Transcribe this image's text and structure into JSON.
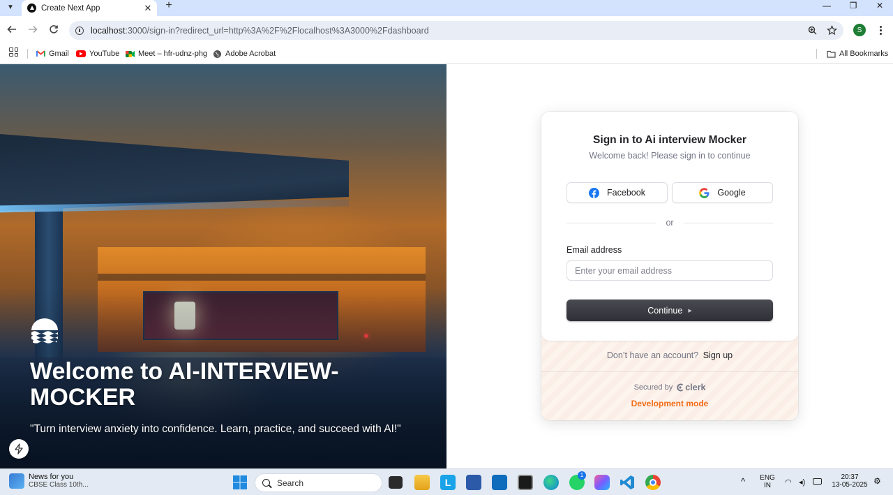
{
  "browser": {
    "tab_title": "Create Next App",
    "url_host": "localhost",
    "url_path": ":3000/sign-in?redirect_url=http%3A%2F%2Flocalhost%3A3000%2Fdashboard",
    "profile_initial": "S"
  },
  "bookmarks": {
    "items": [
      {
        "label": "Gmail",
        "icon": "gmail-icon"
      },
      {
        "label": "YouTube",
        "icon": "youtube-icon"
      },
      {
        "label": "Meet – hfr-udnz-phg",
        "icon": "meet-icon"
      },
      {
        "label": "Adobe Acrobat",
        "icon": "globe-icon"
      }
    ],
    "all_bookmarks": "All Bookmarks"
  },
  "hero": {
    "title": "Welcome to AI-INTERVIEW-MOCKER",
    "quote": "\"Turn interview anxiety into confidence. Learn, practice, and succeed with AI!\""
  },
  "signin": {
    "title": "Sign in to Ai interview Mocker",
    "subtitle": "Welcome back! Please sign in to continue",
    "facebook": "Facebook",
    "google": "Google",
    "divider": "or",
    "email_label": "Email address",
    "email_placeholder": "Enter your email address",
    "email_value": "",
    "continue": "Continue",
    "no_account": "Don’t have an account?",
    "signup": "Sign up",
    "secured_by": "Secured by",
    "clerk": "clerk",
    "dev_mode": "Development mode"
  },
  "taskbar": {
    "news_title": "News for you",
    "news_sub": "CBSE Class 10th...",
    "search": "Search",
    "lang_top": "ENG",
    "lang_bottom": "IN",
    "time": "20:37",
    "date": "13-05-2025",
    "whatsapp_badge": "1"
  },
  "colors": {
    "accent_orange": "#f36b16",
    "button_dark": "#2f3037",
    "chrome_tab_strip": "#d3e3fd"
  }
}
